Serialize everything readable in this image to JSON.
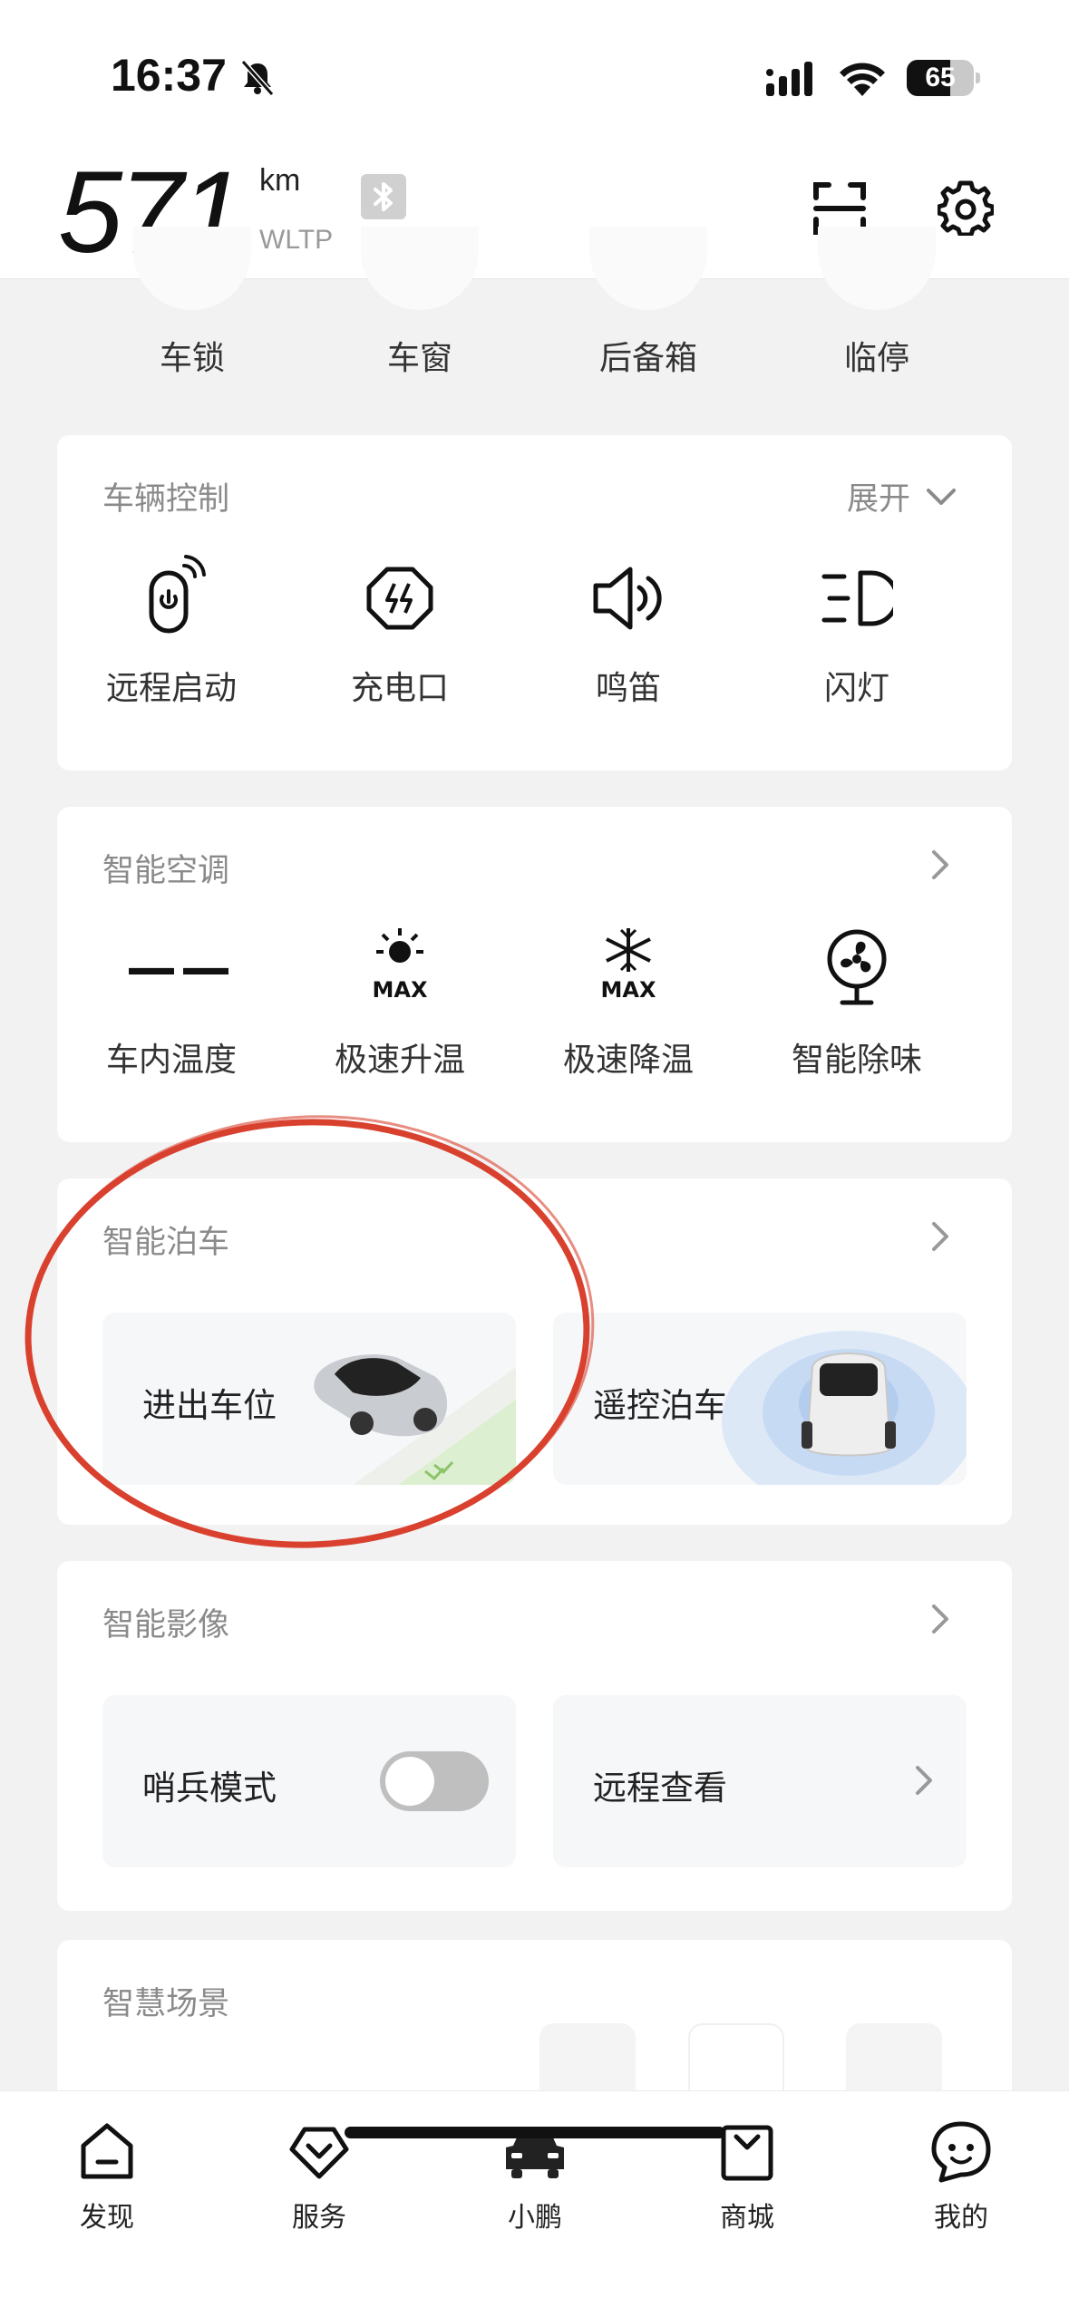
{
  "status": {
    "time": "16:37",
    "battery": "65",
    "battery_level": 0.65
  },
  "header": {
    "range_value": "571",
    "range_unit": "km",
    "range_standard": "WLTP"
  },
  "quick_actions": [
    {
      "label": "车锁"
    },
    {
      "label": "车窗"
    },
    {
      "label": "后备箱"
    },
    {
      "label": "临停"
    }
  ],
  "vehicle_control": {
    "title": "车辆控制",
    "expand_label": "展开",
    "items": [
      {
        "label": "远程启动",
        "icon": "remote-start-icon"
      },
      {
        "label": "充电口",
        "icon": "charge-port-icon"
      },
      {
        "label": "鸣笛",
        "icon": "horn-icon"
      },
      {
        "label": "闪灯",
        "icon": "flash-lights-icon"
      }
    ]
  },
  "climate": {
    "title": "智能空调",
    "items": [
      {
        "label": "车内温度",
        "value": "——",
        "icon": "temperature-icon"
      },
      {
        "label": "极速升温",
        "icon": "max-heat-icon",
        "badge": "MAX"
      },
      {
        "label": "极速降温",
        "icon": "max-cool-icon",
        "badge": "MAX"
      },
      {
        "label": "智能除味",
        "icon": "fan-icon"
      }
    ]
  },
  "parking": {
    "title": "智能泊车",
    "tiles": [
      {
        "label": "进出车位",
        "icon": "car-parking-icon"
      },
      {
        "label": "遥控泊车",
        "icon": "remote-parking-icon"
      }
    ]
  },
  "camera": {
    "title": "智能影像",
    "sentry_label": "哨兵模式",
    "sentry_on": false,
    "remote_view_label": "远程查看"
  },
  "scenes": {
    "title": "智慧场景"
  },
  "bottom_nav": [
    {
      "label": "发现",
      "icon": "home-icon"
    },
    {
      "label": "服务",
      "icon": "service-icon"
    },
    {
      "label": "小鹏",
      "icon": "car-icon"
    },
    {
      "label": "商城",
      "icon": "shop-icon"
    },
    {
      "label": "我的",
      "icon": "profile-icon"
    }
  ]
}
